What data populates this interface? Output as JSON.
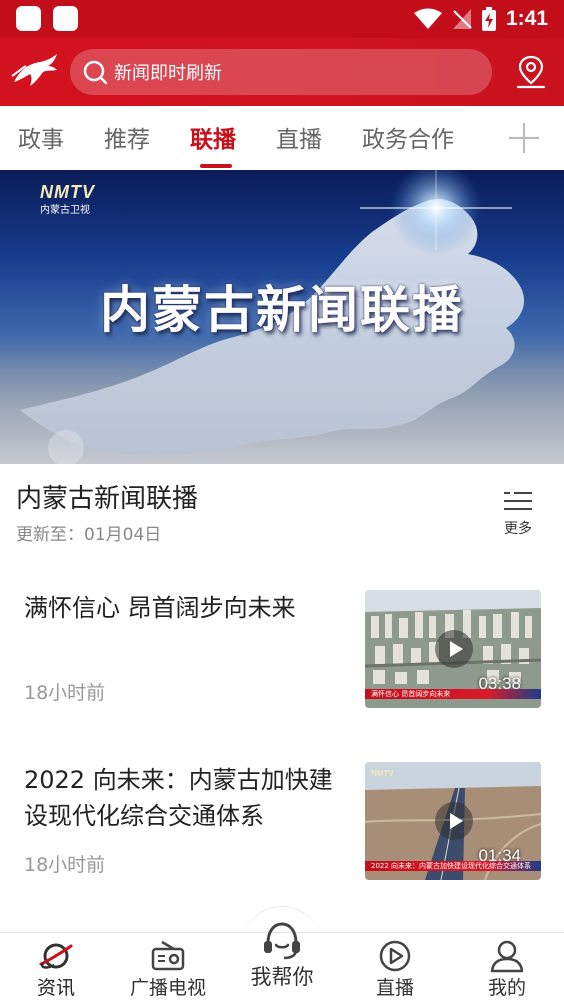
{
  "status_bar": {
    "time": "1:41"
  },
  "header": {
    "search_placeholder": "新闻即时刷新",
    "icons": [
      "horse-logo-icon",
      "search-icon",
      "location-icon"
    ]
  },
  "tabs": [
    {
      "label": "政事"
    },
    {
      "label": "推荐"
    },
    {
      "label": "联播",
      "active": true
    },
    {
      "label": "直播"
    },
    {
      "label": "政务合作"
    }
  ],
  "banner": {
    "logo_text": "NMTV",
    "logo_sub": "内蒙古卫视",
    "title": "内蒙古新闻联播"
  },
  "program": {
    "title": "内蒙古新闻联播",
    "update_text": "更新至：01月04日",
    "more_label": "更多"
  },
  "news": [
    {
      "title": "满怀信心 昂首阔步向未来",
      "time": "18小时前",
      "duration": "03:38",
      "caption": "满怀信心 昂首阔步向未来"
    },
    {
      "title": "2022 向未来：内蒙古加快建设现代化综合交通体系",
      "time": "18小时前",
      "duration": "01:34",
      "caption": "2022 向未来：内蒙古加快建设现代化综合交通体系"
    }
  ],
  "bottom_nav": [
    {
      "label": "资讯",
      "icon": "planet-icon",
      "active": true
    },
    {
      "label": "广播电视",
      "icon": "radio-icon"
    },
    {
      "label": "我帮你",
      "icon": "headset-icon"
    },
    {
      "label": "直播",
      "icon": "play-circle-icon"
    },
    {
      "label": "我的",
      "icon": "user-icon"
    }
  ],
  "colors": {
    "brand_red": "#c8101c",
    "header_red": "#d3121f"
  }
}
